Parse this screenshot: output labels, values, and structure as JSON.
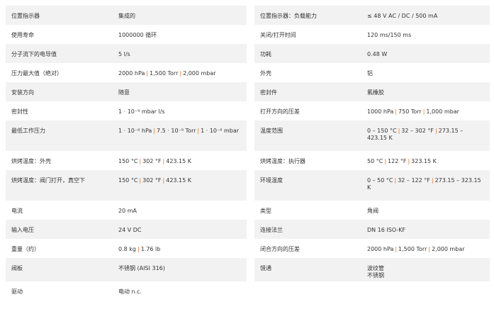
{
  "left": [
    {
      "label": "位置指示器",
      "parts": [
        "集成的"
      ]
    },
    {
      "label": "使用寿命",
      "parts": [
        "1000000 循环"
      ]
    },
    {
      "label": "分子流下的电导值",
      "parts": [
        "5 l/s"
      ]
    },
    {
      "label": "压力最大值（绝对）",
      "parts": [
        "2000 hPa",
        "1,500 Torr",
        "2,000 mbar"
      ]
    },
    {
      "label": "安装方向",
      "parts": [
        "随意"
      ]
    },
    {
      "label": "密封性",
      "parts": [
        "1 · 10⁻⁹ mbar l/s"
      ]
    },
    {
      "label": "最低工作压力",
      "parts": [
        "1 · 10⁻⁸ hPa",
        "7.5 · 10⁻⁹ Torr",
        "1 · 10⁻⁸ mbar"
      ]
    },
    {
      "label": "烘烤温度：外壳",
      "parts": [
        "150 °C",
        "302 °F",
        "423.15 K"
      ]
    },
    {
      "label": "烘烤温度：阀门打开，真空下",
      "parts": [
        "150 °C",
        "302 °F",
        "423.15 K"
      ]
    },
    {
      "label": "电流",
      "parts": [
        "20 mA"
      ]
    },
    {
      "label": "输入电压",
      "parts": [
        "24 V DC"
      ]
    },
    {
      "label": "重量（约）",
      "parts": [
        "0.8 kg",
        "1.76 lb"
      ]
    },
    {
      "label": "阀板",
      "parts": [
        "不锈钢 (AISI 316)"
      ]
    },
    {
      "label": "驱动",
      "parts": [
        "电动 n.c."
      ]
    }
  ],
  "right": [
    {
      "label": "位置指示器：负载能力",
      "parts": [
        "≤ 48 V AC / DC / 500 mA"
      ]
    },
    {
      "label": "关闭/打开时间",
      "parts": [
        "120 ms/150 ms"
      ]
    },
    {
      "label": "功耗",
      "parts": [
        "0.48 W"
      ]
    },
    {
      "label": "外壳",
      "parts": [
        "铝"
      ]
    },
    {
      "label": "密封件",
      "parts": [
        "氟橡胶"
      ]
    },
    {
      "label": "打开方向的压差",
      "parts": [
        "1000 hPa",
        "750 Torr",
        "1,000 mbar"
      ]
    },
    {
      "label": "温度范围",
      "parts": [
        "0 – 150 °C",
        "32 – 302 °F",
        "273.15 – 423.15 K"
      ]
    },
    {
      "label": "烘烤温度：执行器",
      "parts": [
        "50 °C",
        "122 °F",
        "323.15 K"
      ]
    },
    {
      "label": "环境温度",
      "parts": [
        "0 – 50 °C",
        "32 – 122 °F",
        "273.15 – 323.15 K"
      ]
    },
    {
      "label": "类型",
      "parts": [
        "角阀"
      ]
    },
    {
      "label": "连接法兰",
      "parts": [
        "DN 16 ISO-KF"
      ]
    },
    {
      "label": "闭合方向的压差",
      "parts": [
        "2000 hPa",
        "1,500 Torr",
        "2,000 mbar"
      ]
    },
    {
      "label": "馈通",
      "lines": [
        "波纹管",
        "不锈钢"
      ]
    }
  ],
  "colors": {
    "row_shade": "#f2f2f2",
    "separator": "#e07020",
    "text": "#333333"
  }
}
